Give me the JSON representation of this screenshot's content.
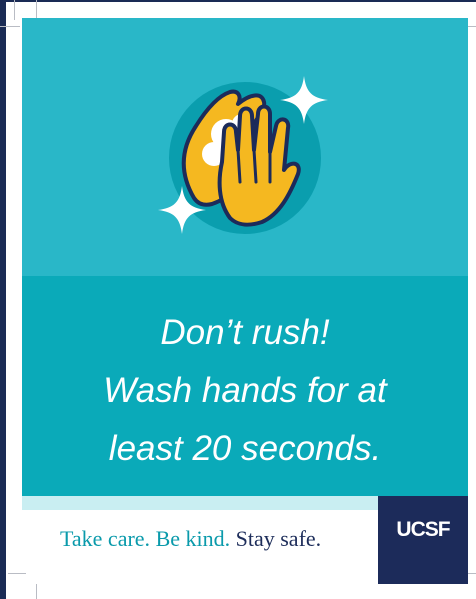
{
  "poster": {
    "message_lines": [
      "Don’t rush!",
      "Wash hands for at",
      "least 20 seconds."
    ],
    "footer": {
      "take_care": "Take care.",
      "be_kind": "Be kind.",
      "stay_safe": "Stay safe."
    },
    "logo_text": "UCSF",
    "icons": [
      "washing-hands-icon",
      "sparkle-icon",
      "sparkle-icon"
    ],
    "colors": {
      "top_panel": "#29b7c8",
      "bottom_panel": "#0aaab9",
      "circle": "#0a9eae",
      "hand_yellow": "#f5b820",
      "navy": "#1c2b5a",
      "footer_teal": "#0a9aab"
    }
  }
}
